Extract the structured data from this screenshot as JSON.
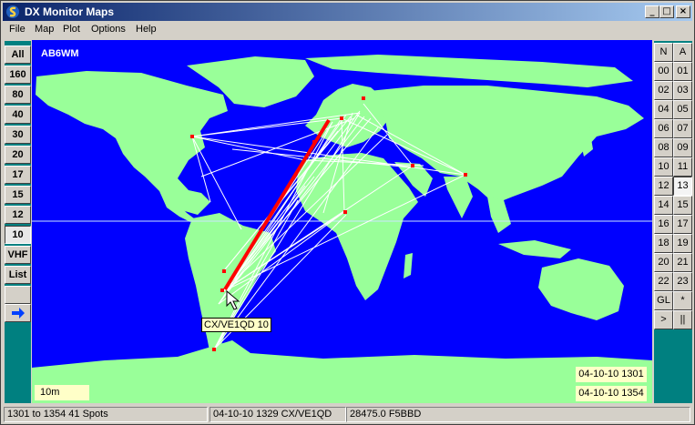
{
  "app": {
    "title": "DX Monitor Maps"
  },
  "title_buttons": {
    "minimize": "_",
    "maximize": "□",
    "close": "×"
  },
  "menu": {
    "items": [
      "File",
      "Map",
      "Plot",
      "Options",
      "Help"
    ]
  },
  "left_bands": {
    "items": [
      "All",
      "160",
      "80",
      "40",
      "30",
      "20",
      "17",
      "15",
      "12",
      "10",
      "VHF",
      "List"
    ],
    "active": "10"
  },
  "map": {
    "callsign": "AB6WM",
    "band": "10m",
    "time_from": "04-10-10 1301",
    "time_to": "04-10-10 1354",
    "selected_spot": "CX/VE1QD 10",
    "colors": {
      "ocean": "#0000ff",
      "land": "#99ff99",
      "paths": "#ffffff",
      "selected_path": "#ff0000",
      "spot": "#ff0000"
    }
  },
  "right_hours": {
    "items": [
      "N",
      "A",
      "00",
      "01",
      "02",
      "03",
      "04",
      "05",
      "06",
      "07",
      "08",
      "09",
      "10",
      "11",
      "12",
      "13",
      "14",
      "15",
      "16",
      "17",
      "18",
      "19",
      "20",
      "21",
      "22",
      "23",
      "GL",
      "*",
      ">",
      "||"
    ],
    "active": "13"
  },
  "status": {
    "range": "1301 to 1354 41 Spots",
    "spot": "04-10-10 1329 CX/VE1QD",
    "freq": "28475.0 F5BBD"
  }
}
